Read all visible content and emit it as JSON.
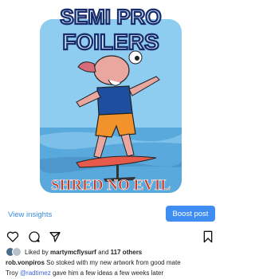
{
  "post": {
    "artwork": {
      "title_line1": "SEMI PRO",
      "title_line2": "FOILERS",
      "slogan": "SHRED NO EVIL",
      "colors": {
        "sky": "#8fcdf0",
        "sea": "#5aa9dd",
        "title_fill": "#bfe3f5",
        "title_outline": "#1a2a6a",
        "slogan": "#c43b2a"
      }
    },
    "view_insights": "View insights",
    "boost_post": "Boost post",
    "liked_prefix": "Liked by",
    "liked_user": "martymcflysurf",
    "liked_and": "and",
    "liked_others": "117 others",
    "caption_user": "rob.vonpiros",
    "caption_text": "So stoked with my new artwork from good mate",
    "caption_line2_prefix": "Troy",
    "caption_mention": "@radtimez",
    "caption_line2_suffix": "gave him a few ideas a few weeks later"
  }
}
